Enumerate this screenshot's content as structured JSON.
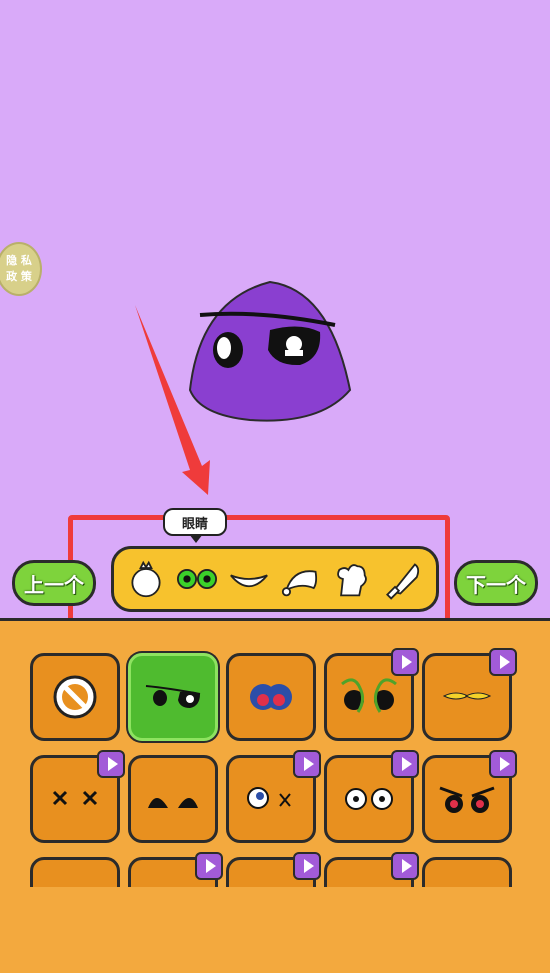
{
  "privacy": {
    "line1": "隐 私",
    "line2": "政 策"
  },
  "category_label": "眼睛",
  "nav": {
    "prev_label": "上一个",
    "next_label": "下一个"
  },
  "categories": [
    {
      "name": "body-icon"
    },
    {
      "name": "eyes-icon"
    },
    {
      "name": "mouth-icon"
    },
    {
      "name": "hat-icon"
    },
    {
      "name": "glove-icon"
    },
    {
      "name": "knife-icon"
    }
  ],
  "tiles": [
    {
      "name": "none-icon",
      "selected": false,
      "ad": false
    },
    {
      "name": "eyepatch-eyes-icon",
      "selected": true,
      "ad": false
    },
    {
      "name": "red-heart-eyes-icon",
      "selected": false,
      "ad": false
    },
    {
      "name": "snake-eyes-icon",
      "selected": false,
      "ad": true
    },
    {
      "name": "yellow-sleepy-eyes-icon",
      "selected": false,
      "ad": true
    },
    {
      "name": "x-eyes-icon",
      "selected": false,
      "ad": true
    },
    {
      "name": "half-closed-eyes-icon",
      "selected": false,
      "ad": false
    },
    {
      "name": "crazy-eyes-icon",
      "selected": false,
      "ad": true
    },
    {
      "name": "round-white-eyes-icon",
      "selected": false,
      "ad": true
    },
    {
      "name": "angry-red-eyes-icon",
      "selected": false,
      "ad": true
    },
    {
      "name": "tile-11-icon",
      "selected": false,
      "ad": false
    },
    {
      "name": "tile-12-icon",
      "selected": false,
      "ad": true
    },
    {
      "name": "tile-13-icon",
      "selected": false,
      "ad": true
    },
    {
      "name": "tile-14-icon",
      "selected": false,
      "ad": true
    },
    {
      "name": "tile-15-icon",
      "selected": false,
      "ad": false
    }
  ],
  "colors": {
    "stage": "#d9aaf9",
    "panel": "#f3a93e",
    "tile": "#e8901f",
    "selected": "#4fbb2f",
    "highlight": "#ef3b3b"
  }
}
